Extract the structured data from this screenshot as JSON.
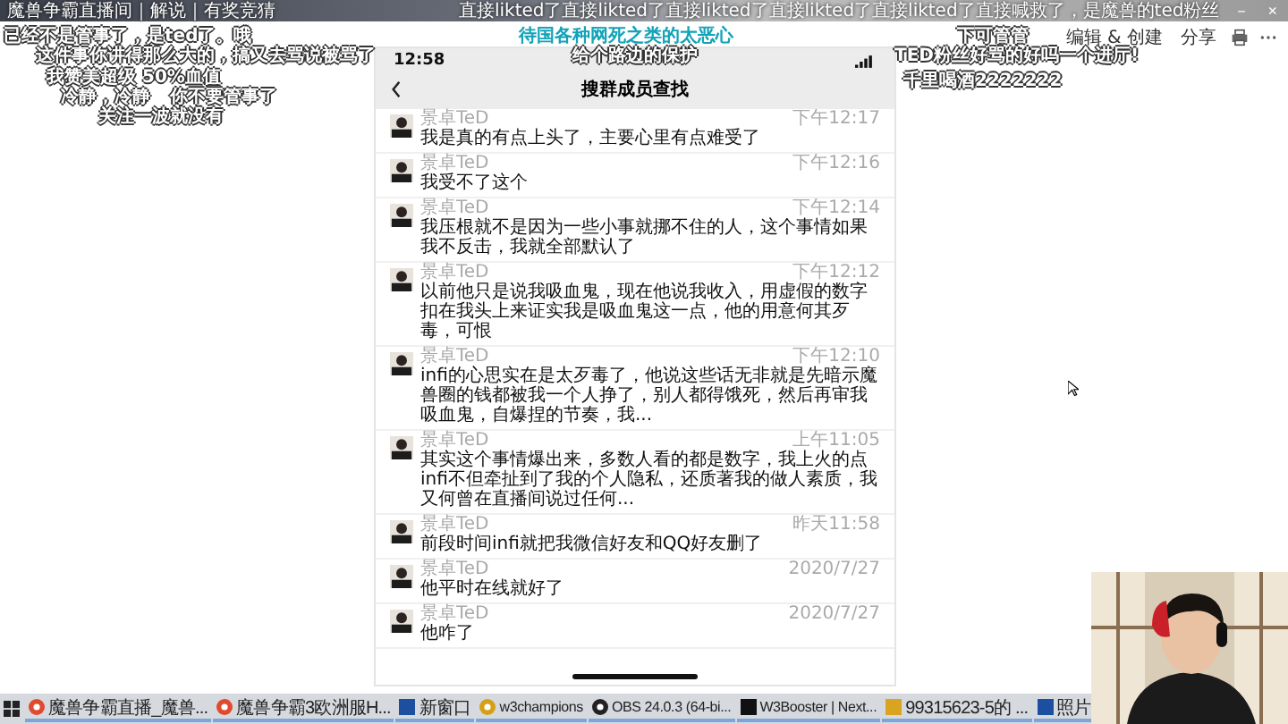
{
  "title_bar": {
    "title": "魔兽争霸直播间｜解说｜有奖竞猜",
    "scrolling_text": "直接likted了直接likted了直接likted了直接likted了直接likted了直接喊救了，是魔兽的ted粉丝",
    "controls": [
      "－",
      "×"
    ]
  },
  "danmaku": [
    {
      "text": "已经不是管事了，是ted了。哦",
      "kind": "plain"
    },
    {
      "text": "这件事你讲得那么大的，搞又去骂说被骂了",
      "kind": "plain"
    },
    {
      "text": "我赞美超级 50%血值",
      "kind": "plain"
    },
    {
      "text": "冷静，冷静",
      "kind": "plain"
    },
    {
      "text": "你不要管事了",
      "kind": "plain"
    },
    {
      "text": "关注一波就没有",
      "kind": "plain"
    },
    {
      "text": "待国各种网死之类的太恶心",
      "kind": "highlight"
    },
    {
      "text": "给个路边的保护",
      "kind": "plain"
    },
    {
      "text": "下可管管",
      "kind": "plain"
    },
    {
      "text": "TED粉丝好骂的好吗一个进厅!",
      "kind": "plain"
    },
    {
      "text": "千里喝酒2222222",
      "kind": "plain"
    }
  ],
  "toolbar": {
    "items": [
      "编辑 & 创建",
      "分享"
    ]
  },
  "phone": {
    "time": "12:58",
    "title": "搜群成员查找",
    "messages": [
      {
        "name": "景卓TeD",
        "time": "下午12:17",
        "text": "我是真的有点上头了，主要心里有点难受了"
      },
      {
        "name": "景卓TeD",
        "time": "下午12:16",
        "text": "我受不了这个"
      },
      {
        "name": "景卓TeD",
        "time": "下午12:14",
        "text": "我压根就不是因为一些小事就挪不住的人，这个事情如果我不反击，我就全部默认了"
      },
      {
        "name": "景卓TeD",
        "time": "下午12:12",
        "text": "以前他只是说我吸血鬼，现在他说我收入，用虚假的数字扣在我头上来证实我是吸血鬼这一点，他的用意何其歹毒，可恨"
      },
      {
        "name": "景卓TeD",
        "time": "下午12:10",
        "text": "infi的心思实在是太歹毒了，他说这些话无非就是先暗示魔兽圈的钱都被我一个人挣了，别人都得饿死，然后再审我吸血鬼，自爆捏的节奏，我..."
      },
      {
        "name": "景卓TeD",
        "time": "上午11:05",
        "text": "其实这个事情爆出来，多数人看的都是数字，我上火的点infi不但牵扯到了我的个人隐私，还质著我的做人素质，我又何曾在直播间说过任何..."
      },
      {
        "name": "景卓TeD",
        "time": "昨天11:58",
        "text": "前段时间infi就把我微信好友和QQ好友删了"
      },
      {
        "name": "景卓TeD",
        "time": "2020/7/27",
        "text": "他平时在线就好了"
      },
      {
        "name": "景卓TeD",
        "time": "2020/7/27",
        "text": "他咋了"
      }
    ]
  },
  "taskbar": {
    "items": [
      {
        "label": "魔兽争霸直播_魔兽...",
        "kind": "browser"
      },
      {
        "label": "魔兽争霸3欧洲服H...",
        "kind": "browser"
      },
      {
        "label": "新窗口",
        "kind": "window"
      },
      {
        "label": "w3champions",
        "kind": "game"
      },
      {
        "label": "OBS 24.0.3 (64-bi...",
        "kind": "obs"
      },
      {
        "label": "W3Booster | Next...",
        "kind": "booster"
      },
      {
        "label": "99315623-5的 ...",
        "kind": "chat"
      },
      {
        "label": "照片",
        "kind": "window"
      }
    ]
  }
}
